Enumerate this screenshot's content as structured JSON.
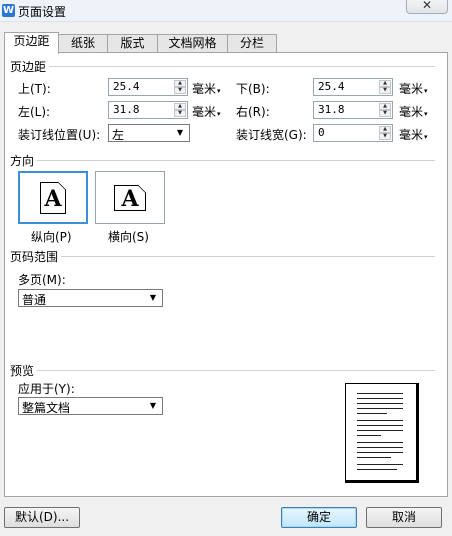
{
  "window": {
    "title": "页面设置",
    "close_label": "✕"
  },
  "tabs": [
    {
      "label": "页边距",
      "active": true
    },
    {
      "label": "纸张",
      "active": false
    },
    {
      "label": "版式",
      "active": false
    },
    {
      "label": "文档网格",
      "active": false
    },
    {
      "label": "分栏",
      "active": false
    }
  ],
  "margins": {
    "section_title": "页边距",
    "top": {
      "label": "上(T):",
      "value": "25.4",
      "unit": "毫米"
    },
    "bottom": {
      "label": "下(B):",
      "value": "25.4",
      "unit": "毫米"
    },
    "left": {
      "label": "左(L):",
      "value": "31.8",
      "unit": "毫米"
    },
    "right": {
      "label": "右(R):",
      "value": "31.8",
      "unit": "毫米"
    },
    "gutter_position": {
      "label": "装订线位置(U):",
      "value": "左"
    },
    "gutter_width": {
      "label": "装订线宽(G):",
      "value": "0",
      "unit": "毫米"
    }
  },
  "orientation": {
    "section_title": "方向",
    "portrait": {
      "label": "纵向(P)",
      "glyph": "A",
      "selected": true
    },
    "landscape": {
      "label": "横向(S)",
      "glyph": "A",
      "selected": false
    }
  },
  "page_range": {
    "section_title": "页码范围",
    "multiple_pages": {
      "label": "多页(M):",
      "value": "普通"
    }
  },
  "preview": {
    "section_title": "预览",
    "apply_to": {
      "label": "应用于(Y):",
      "value": "整篇文档"
    }
  },
  "buttons": {
    "default": "默认(D)...",
    "ok": "确定",
    "cancel": "取消"
  },
  "icons": {
    "app": "wps-writer-icon",
    "spin_up": "▲",
    "spin_down": "▼",
    "dropdown": "▾",
    "combo_arrow": "▼"
  }
}
